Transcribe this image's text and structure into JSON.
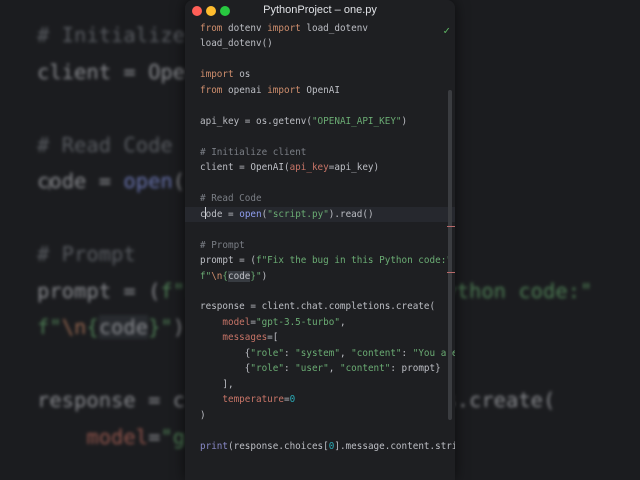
{
  "window": {
    "title": "PythonProject – one.py",
    "file_status_icon": "check-icon"
  },
  "colors": {
    "keyword": "#cf8e6d",
    "string": "#6aab73",
    "comment": "#7a7e85",
    "param": "#c77467",
    "number": "#2aacb8",
    "background": "#1e1f22"
  },
  "editor": {
    "cursor_line": 13,
    "lines": [
      [
        [
          "from ",
          "kw"
        ],
        [
          "dotenv ",
          ""
        ],
        [
          "import ",
          "kw"
        ],
        [
          "load_dotenv",
          ""
        ]
      ],
      [
        [
          "load_dotenv()",
          ""
        ]
      ],
      [],
      [
        [
          "import ",
          "kw"
        ],
        [
          "os",
          ""
        ]
      ],
      [
        [
          "from ",
          "kw"
        ],
        [
          "openai ",
          ""
        ],
        [
          "import ",
          "kw"
        ],
        [
          "OpenAI",
          ""
        ]
      ],
      [],
      [
        [
          "api_key = os.getenv(",
          ""
        ],
        [
          "\"OPENAI_API_KEY\"",
          "str"
        ],
        [
          ")",
          ""
        ]
      ],
      [],
      [
        [
          "# Initialize client",
          "cm"
        ]
      ],
      [
        [
          "client = OpenAI(",
          ""
        ],
        [
          "api_key",
          "par"
        ],
        [
          "=api_key)",
          ""
        ]
      ],
      [],
      [
        [
          "# Read Code",
          "cm"
        ]
      ],
      [
        [
          "co",
          "caret"
        ],
        [
          "de = ",
          ""
        ],
        [
          "open",
          "fn"
        ],
        [
          "(",
          ""
        ],
        [
          "\"script.py\"",
          "str"
        ],
        [
          ").read()",
          ""
        ]
      ],
      [],
      [
        [
          "# Prompt",
          "cm"
        ]
      ],
      [
        [
          "prompt = (",
          ""
        ],
        [
          "f\"Fix the bug in this Python code:\"",
          "str"
        ]
      ],
      [
        [
          "f\"",
          "str"
        ],
        [
          "\\n",
          "kw"
        ],
        [
          "{",
          "str"
        ],
        [
          "code",
          "hl"
        ],
        [
          "}\"",
          "str"
        ],
        [
          ")",
          ""
        ]
      ],
      [],
      [
        [
          "response = client.chat.completions.create(",
          ""
        ]
      ],
      [
        [
          "    ",
          ""
        ],
        [
          "model",
          "par"
        ],
        [
          "=",
          ""
        ],
        [
          "\"gpt-3.5-turbo\"",
          "str"
        ],
        [
          ",",
          ""
        ]
      ],
      [
        [
          "    ",
          ""
        ],
        [
          "messages",
          "par"
        ],
        [
          "=[",
          ""
        ]
      ],
      [
        [
          "        {",
          ""
        ],
        [
          "\"role\"",
          "str"
        ],
        [
          ": ",
          ""
        ],
        [
          "\"system\"",
          "str"
        ],
        [
          ", ",
          ""
        ],
        [
          "\"content\"",
          "str"
        ],
        [
          ": ",
          ""
        ],
        [
          "\"You are a helpful assistant.\"",
          "str"
        ],
        [
          "},",
          ""
        ]
      ],
      [
        [
          "        {",
          ""
        ],
        [
          "\"role\"",
          "str"
        ],
        [
          ": ",
          ""
        ],
        [
          "\"user\"",
          "str"
        ],
        [
          ", ",
          ""
        ],
        [
          "\"content\"",
          "str"
        ],
        [
          ": prompt}",
          ""
        ]
      ],
      [
        [
          "    ],",
          ""
        ]
      ],
      [
        [
          "    ",
          ""
        ],
        [
          "temperature",
          "par"
        ],
        [
          "=",
          ""
        ],
        [
          "0",
          "num"
        ]
      ],
      [
        [
          ")",
          ""
        ]
      ],
      [],
      [
        [
          "print",
          "bi"
        ],
        [
          "(response.choices[",
          ""
        ],
        [
          "0",
          "num"
        ],
        [
          "].message.content.strip())",
          ""
        ]
      ]
    ]
  }
}
